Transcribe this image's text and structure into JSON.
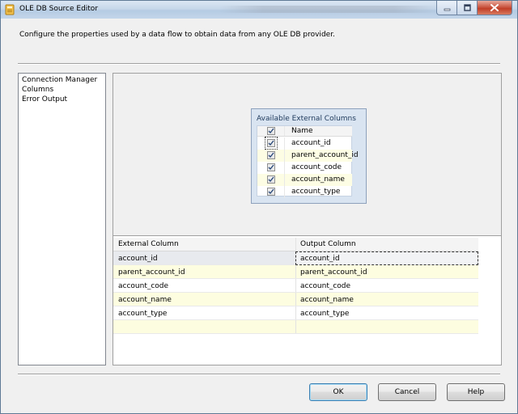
{
  "window": {
    "title": "OLE DB Source Editor",
    "icon": "ssis-source-icon"
  },
  "description": "Configure the properties used by a data flow to obtain data from any OLE DB provider.",
  "nav": {
    "items": [
      "Connection Manager",
      "Columns",
      "Error Output"
    ]
  },
  "available_columns": {
    "title": "Available External Columns",
    "header": "Name",
    "items": [
      {
        "name": "account_id",
        "checked": true
      },
      {
        "name": "parent_account_id",
        "checked": true
      },
      {
        "name": "account_code",
        "checked": true
      },
      {
        "name": "account_name",
        "checked": true
      },
      {
        "name": "account_type",
        "checked": true
      }
    ]
  },
  "mapping": {
    "headers": {
      "external": "External Column",
      "output": "Output Column"
    },
    "rows": [
      {
        "external": "account_id",
        "output": "account_id"
      },
      {
        "external": "parent_account_id",
        "output": "parent_account_id"
      },
      {
        "external": "account_code",
        "output": "account_code"
      },
      {
        "external": "account_name",
        "output": "account_name"
      },
      {
        "external": "account_type",
        "output": "account_type"
      }
    ]
  },
  "buttons": {
    "ok": "OK",
    "cancel": "Cancel",
    "help": "Help"
  },
  "colors": {
    "titlebar": "#c6d7ea",
    "close_button": "#c74e39",
    "row_alt": "#fdfde0",
    "default_button_border": "#3c7fb1"
  }
}
